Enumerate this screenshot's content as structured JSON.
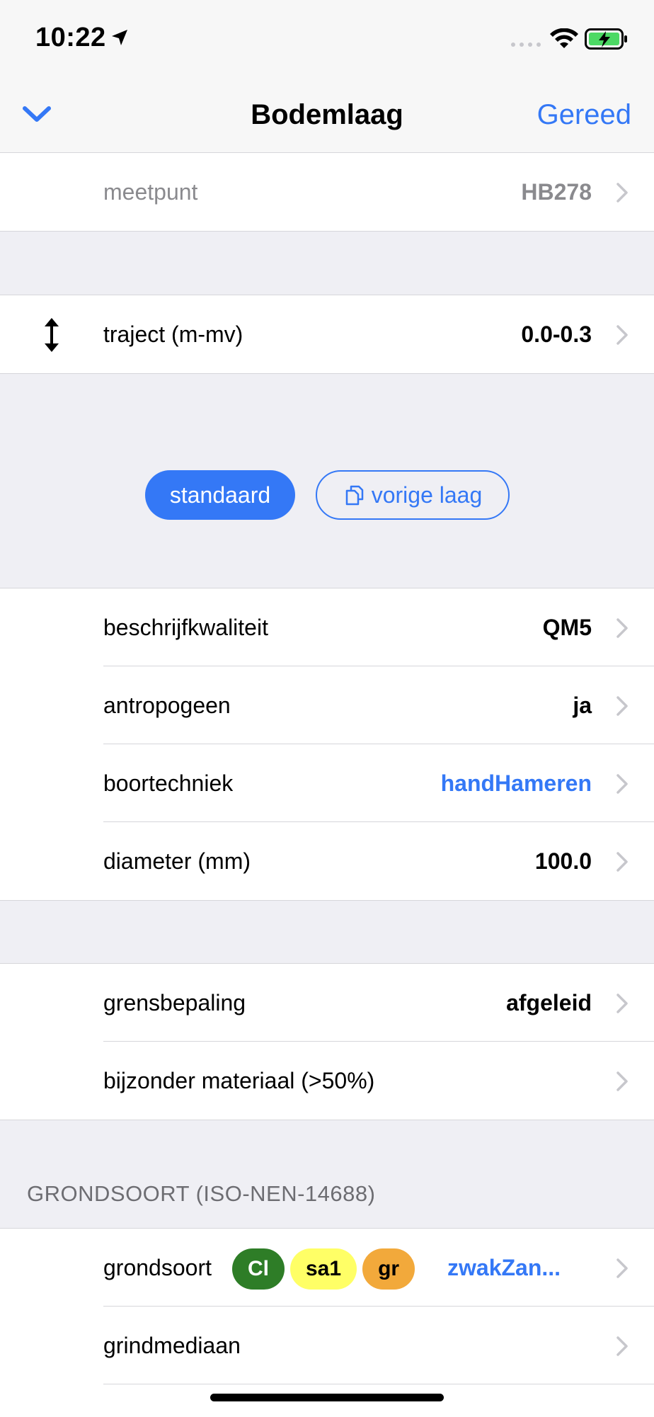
{
  "status": {
    "time": "10:22"
  },
  "nav": {
    "title": "Bodemlaag",
    "done_label": "Gereed"
  },
  "meetpunt": {
    "label": "meetpunt",
    "value": "HB278"
  },
  "traject": {
    "label": "traject (m-mv)",
    "value": "0.0-0.3"
  },
  "buttons": {
    "standaard": "standaard",
    "vorige_laag": "vorige laag"
  },
  "details": [
    {
      "label": "beschrijfkwaliteit",
      "value": "QM5"
    },
    {
      "label": "antropogeen",
      "value": "ja"
    },
    {
      "label": "boortechniek",
      "value": "handHameren"
    },
    {
      "label": "diameter (mm)",
      "value": "100.0"
    }
  ],
  "grens": [
    {
      "label": "grensbepaling",
      "value": "afgeleid"
    },
    {
      "label": "bijzonder materiaal (>50%)",
      "value": ""
    }
  ],
  "grondsoort_section": {
    "header": "GRONDSOORT (ISO-NEN-14688)",
    "grondsoort_label": "grondsoort",
    "chips": [
      "Cl",
      "sa1",
      "gr"
    ],
    "chip_colors": [
      "#2e7d27",
      "#ffff66",
      "#f2a93b"
    ],
    "grondsoort_value": "zwakZan...",
    "grindmediaan_label": "grindmediaan"
  },
  "colors": {
    "accent": "#3478f6",
    "background": "#efeff4"
  }
}
